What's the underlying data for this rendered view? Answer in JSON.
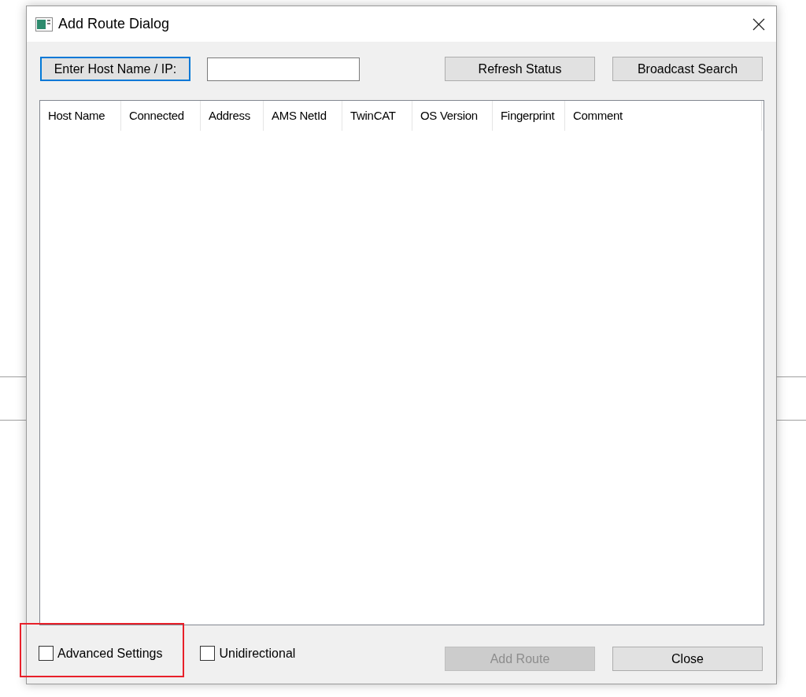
{
  "window": {
    "title": "Add Route Dialog"
  },
  "host_button": {
    "label": "Enter Host Name / IP:",
    "focused": true
  },
  "top_buttons": [
    {
      "label": "Refresh Status",
      "disabled": false
    },
    {
      "label": "Broadcast Search",
      "disabled": false
    }
  ],
  "table": {
    "columns": [
      {
        "label": "Host Name"
      },
      {
        "label": "Connected"
      },
      {
        "label": "Address"
      },
      {
        "label": "AMS NetId"
      },
      {
        "label": "TwinCAT"
      },
      {
        "label": "OS Version"
      },
      {
        "label": "Fingerprint"
      },
      {
        "label": "Comment"
      }
    ]
  },
  "options": [
    {
      "label": "Advanced Settings",
      "checked": false,
      "highlighted": true
    },
    {
      "label": "Unidirectional",
      "checked": false,
      "highlighted": false
    }
  ],
  "bottom_buttons": [
    {
      "label": "Add Route",
      "disabled": true
    },
    {
      "label": "Close",
      "disabled": false
    }
  ]
}
